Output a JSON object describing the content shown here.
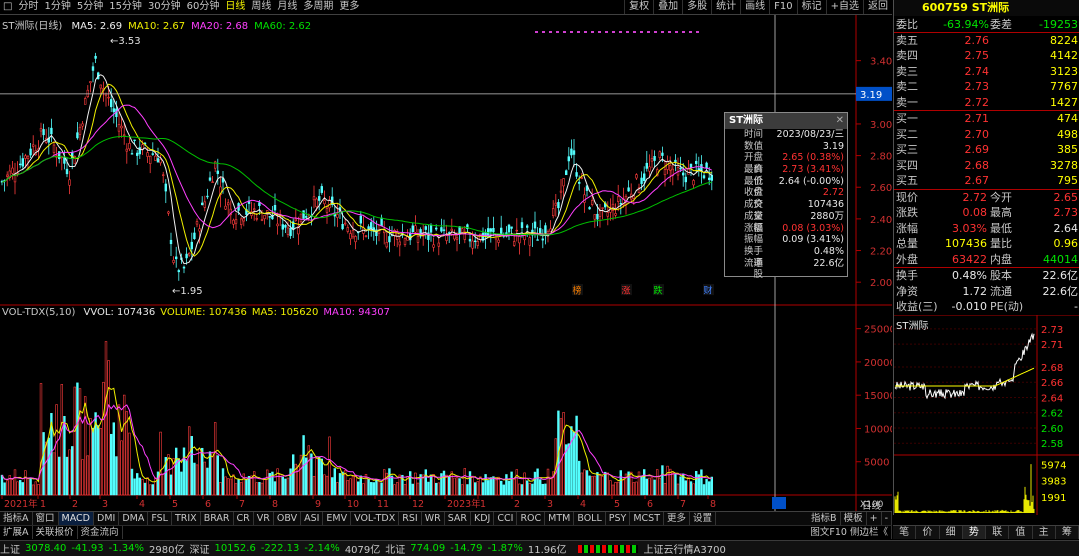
{
  "toolbar": {
    "periods": [
      "分时",
      "1分钟",
      "5分钟",
      "15分钟",
      "30分钟",
      "60分钟",
      "日线",
      "周线",
      "月线",
      "多周期",
      "更多"
    ],
    "active": "日线",
    "buttons": [
      "复权",
      "叠加",
      "多股",
      "统计",
      "画线",
      "F10",
      "标记",
      "+自选",
      "返回"
    ]
  },
  "price_panel": {
    "title": "ST洲际(日线)",
    "ma": [
      {
        "label": "MA5: 2.69",
        "color": "#f0f0f0"
      },
      {
        "label": "MA10: 2.67",
        "color": "#f0f000"
      },
      {
        "label": "MA20: 2.68",
        "color": "#ff40ff"
      },
      {
        "label": "MA60: 2.62",
        "color": "#00e000"
      }
    ],
    "yticks": [
      "3.40",
      "3.20",
      "3.00",
      "2.80",
      "2.60",
      "2.40",
      "2.20",
      "2.00"
    ],
    "high_label": "3.53",
    "low_label": "1.95",
    "cursor_price": "3.19",
    "markers": [
      "榜",
      "涨",
      "跌",
      "财"
    ]
  },
  "tooltip": {
    "title": "ST洲际",
    "rows": [
      {
        "k": "时间",
        "v": "2023/08/23/三",
        "c": "#e8e8e8"
      },
      {
        "k": "数值",
        "v": "3.19",
        "c": "#e8e8e8"
      },
      {
        "k": "开盘价",
        "v": "2.65 (0.38%)",
        "c": "#ff3232"
      },
      {
        "k": "最高价",
        "v": "2.73 (3.41%)",
        "c": "#ff3232"
      },
      {
        "k": "最低价",
        "v": "2.64 (-0.00%)",
        "c": "#e8e8e8"
      },
      {
        "k": "收盘价",
        "v": "2.72",
        "c": "#ff3232"
      },
      {
        "k": "成交量",
        "v": "107436",
        "c": "#e8e8e8"
      },
      {
        "k": "成交额",
        "v": "2880万",
        "c": "#e8e8e8"
      },
      {
        "k": "涨幅",
        "v": "0.08 (3.03%)",
        "c": "#ff3232"
      },
      {
        "k": "振幅",
        "v": "0.09 (3.41%)",
        "c": "#e8e8e8"
      },
      {
        "k": "换手率",
        "v": "0.48%",
        "c": "#e8e8e8"
      },
      {
        "k": "流通股",
        "v": "22.6亿",
        "c": "#e8e8e8"
      }
    ]
  },
  "vol_panel": {
    "title": "VOL-TDX(5,10)",
    "items": [
      {
        "label": "VVOL: 107436",
        "color": "#e8e8e8"
      },
      {
        "label": "VOLUME: 107436",
        "color": "#f0f000"
      },
      {
        "label": "MA5: 105620",
        "color": "#f0f000"
      },
      {
        "label": "MA10: 94307",
        "color": "#ff40ff"
      }
    ],
    "yticks": [
      "25000",
      "20000",
      "15000",
      "10000",
      "5000"
    ],
    "unit": "X100"
  },
  "xaxis": {
    "labels": [
      "2021年",
      "1",
      "2",
      "3",
      "4",
      "5",
      "6",
      "7",
      "8",
      "9",
      "10",
      "11",
      "12",
      "2023年",
      "1",
      "2",
      "3",
      "4",
      "5",
      "6",
      "7",
      "8"
    ],
    "period_label": "日线"
  },
  "quote": {
    "code_name": "600759 ST洲际",
    "weibi_label": "委比",
    "weibi": "-63.94%",
    "weicha_label": "委差",
    "weicha": "-19253",
    "sell": [
      {
        "l": "卖五",
        "p": "2.76",
        "v": "8224"
      },
      {
        "l": "卖四",
        "p": "2.75",
        "v": "4142"
      },
      {
        "l": "卖三",
        "p": "2.74",
        "v": "3123"
      },
      {
        "l": "卖二",
        "p": "2.73",
        "v": "7767"
      },
      {
        "l": "卖一",
        "p": "2.72",
        "v": "1427"
      }
    ],
    "buy": [
      {
        "l": "买一",
        "p": "2.71",
        "v": "474"
      },
      {
        "l": "买二",
        "p": "2.70",
        "v": "498"
      },
      {
        "l": "买三",
        "p": "2.69",
        "v": "385"
      },
      {
        "l": "买四",
        "p": "2.68",
        "v": "3278"
      },
      {
        "l": "买五",
        "p": "2.67",
        "v": "795"
      }
    ],
    "stats": [
      [
        {
          "k": "现价",
          "v": "2.72",
          "c": "#ff3232"
        },
        {
          "k": "今开",
          "v": "2.65",
          "c": "#ff3232"
        }
      ],
      [
        {
          "k": "涨跌",
          "v": "0.08",
          "c": "#ff3232"
        },
        {
          "k": "最高",
          "v": "2.73",
          "c": "#ff3232"
        }
      ],
      [
        {
          "k": "涨幅",
          "v": "3.03%",
          "c": "#ff3232"
        },
        {
          "k": "最低",
          "v": "2.64",
          "c": "#e8e8e8"
        }
      ],
      [
        {
          "k": "总量",
          "v": "107436",
          "c": "#ffff00"
        },
        {
          "k": "量比",
          "v": "0.96",
          "c": "#ffff00"
        }
      ],
      [
        {
          "k": "外盘",
          "v": "63422",
          "c": "#ff3232"
        },
        {
          "k": "内盘",
          "v": "44014",
          "c": "#00e600"
        }
      ]
    ],
    "stats2": [
      [
        {
          "k": "换手",
          "v": "0.48%",
          "c": "#e8e8e8"
        },
        {
          "k": "股本",
          "v": "22.6亿",
          "c": "#e8e8e8"
        }
      ],
      [
        {
          "k": "净资",
          "v": "1.72",
          "c": "#e8e8e8"
        },
        {
          "k": "流通",
          "v": "22.6亿",
          "c": "#e8e8e8"
        }
      ],
      [
        {
          "k": "收益(三)",
          "v": "-0.010",
          "c": "#e8e8e8"
        },
        {
          "k": "PE(动)",
          "v": "-",
          "c": "#e8e8e8"
        }
      ]
    ]
  },
  "mini": {
    "title": "ST洲际",
    "price_ticks": [
      "2.73",
      "2.71",
      "2.68",
      "2.66",
      "2.64",
      "2.62",
      "2.60",
      "2.58"
    ],
    "vol_ticks": [
      "5974",
      "3983",
      "1991"
    ]
  },
  "indicator_tabs": [
    "指标A",
    "窗口",
    "MACD",
    "DMI",
    "DMA",
    "FSL",
    "TRIX",
    "BRAR",
    "CR",
    "VR",
    "OBV",
    "ASI",
    "EMV",
    "VOL-TDX",
    "RSI",
    "WR",
    "SAR",
    "KDJ",
    "CCI",
    "ROC",
    "MTM",
    "BOLL",
    "PSY",
    "MCST",
    "更多",
    "设置"
  ],
  "indicator_selected": "MACD",
  "indicator_right": [
    "指标B",
    "模板",
    "+",
    "-"
  ],
  "row2_tabs": [
    "扩展A",
    "关联报价",
    "资金流向"
  ],
  "row2_right": "图文F10 侧边栏《",
  "right_tabs": [
    "笔",
    "价",
    "细",
    "势",
    "联",
    "值",
    "主",
    "筹"
  ],
  "right_selected": "势",
  "status": [
    {
      "t": "上证",
      "c": "#c8c8c8"
    },
    {
      "t": "3078.40",
      "c": "#00e600"
    },
    {
      "t": "-41.93",
      "c": "#00e600"
    },
    {
      "t": "-1.34%",
      "c": "#00e600"
    },
    {
      "t": "2980亿",
      "c": "#c8c8c8"
    },
    {
      "t": "深证",
      "c": "#c8c8c8"
    },
    {
      "t": "10152.6",
      "c": "#00e600"
    },
    {
      "t": "-222.13",
      "c": "#00e600"
    },
    {
      "t": "-2.14%",
      "c": "#00e600"
    },
    {
      "t": "4079亿",
      "c": "#c8c8c8"
    },
    {
      "t": "北证",
      "c": "#c8c8c8"
    },
    {
      "t": "774.09",
      "c": "#00e600"
    },
    {
      "t": "-14.79",
      "c": "#00e600"
    },
    {
      "t": "-1.87%",
      "c": "#00e600"
    },
    {
      "t": "11.96亿",
      "c": "#c8c8c8"
    }
  ],
  "status_right": "上证云行情A3700"
}
